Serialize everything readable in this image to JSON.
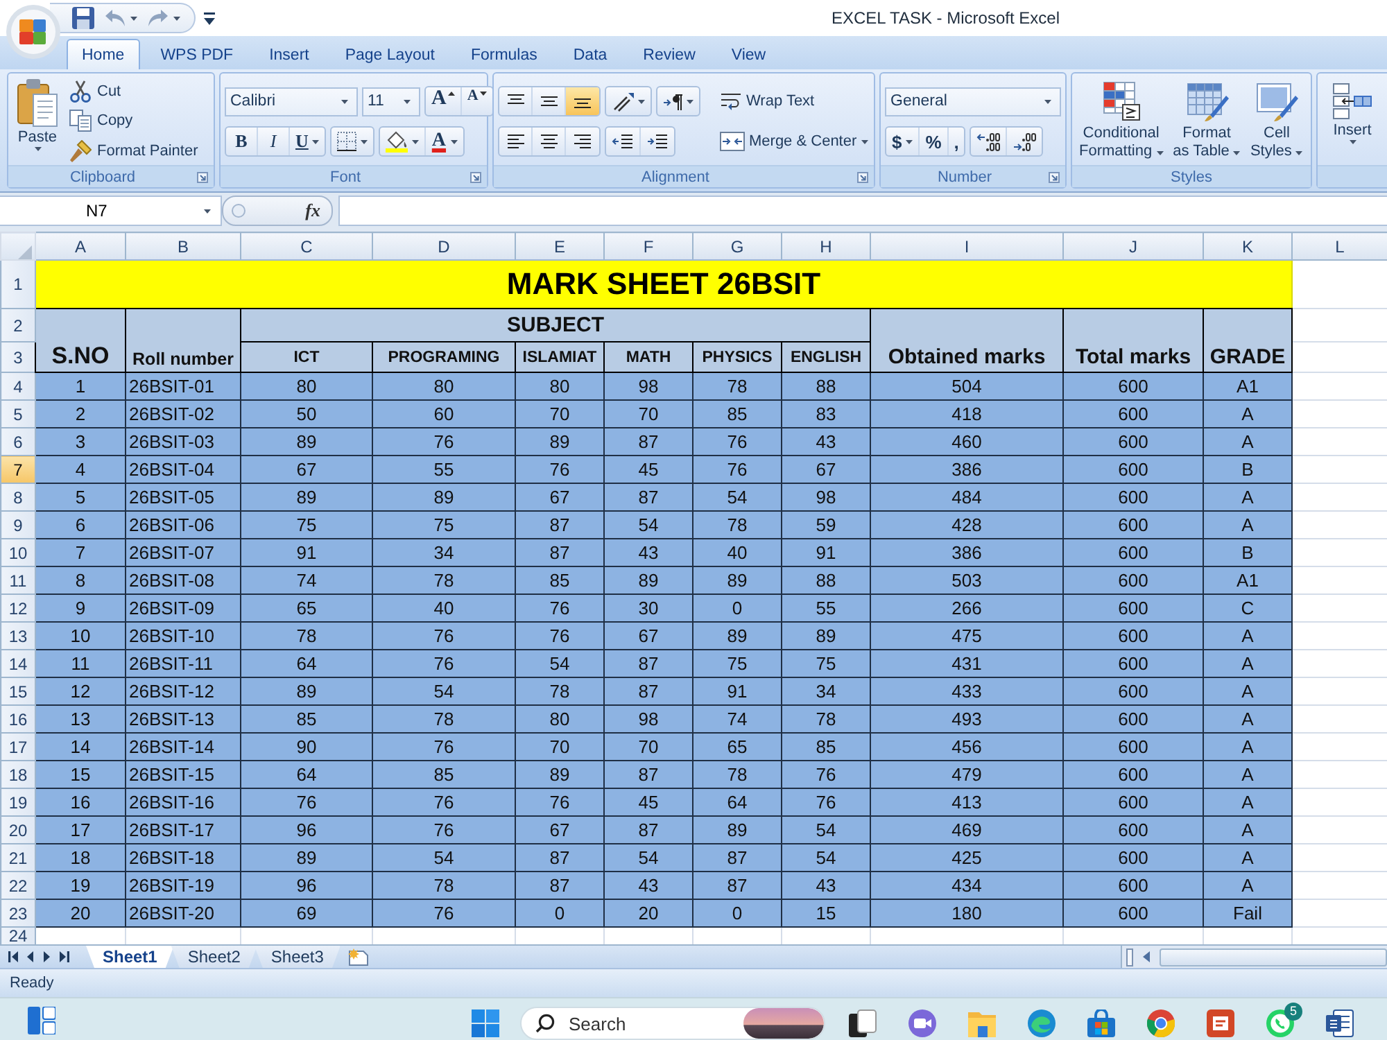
{
  "window": {
    "title": "EXCEL TASK - Microsoft Excel"
  },
  "ribbon_tabs": [
    {
      "label": "Home",
      "selected": true
    },
    {
      "label": "WPS PDF",
      "selected": false
    },
    {
      "label": "Insert",
      "selected": false
    },
    {
      "label": "Page Layout",
      "selected": false
    },
    {
      "label": "Formulas",
      "selected": false
    },
    {
      "label": "Data",
      "selected": false
    },
    {
      "label": "Review",
      "selected": false
    },
    {
      "label": "View",
      "selected": false
    }
  ],
  "clipboard": {
    "title": "Clipboard",
    "paste": "Paste",
    "cut": "Cut",
    "copy": "Copy",
    "format_painter": "Format Painter"
  },
  "font": {
    "title": "Font",
    "font_name": "Calibri",
    "font_size": "11",
    "grow_label": "A",
    "shrink_label": "A",
    "style_buttons": [
      {
        "kind": "bold",
        "label": "B"
      },
      {
        "kind": "italic",
        "label": "I"
      },
      {
        "kind": "underline",
        "label": "U"
      }
    ],
    "font_color_label": "A"
  },
  "alignment": {
    "title": "Alignment",
    "vertical_buttons": [
      {
        "kind": "top",
        "selected": false
      },
      {
        "kind": "middle",
        "selected": false
      },
      {
        "kind": "bottom",
        "selected": true
      }
    ],
    "wrap_text": "Wrap Text",
    "merge_center": "Merge & Center"
  },
  "number": {
    "title": "Number",
    "format": "General",
    "buttons": [
      {
        "kind": "currency",
        "label": "$"
      },
      {
        "kind": "percent",
        "label": "%"
      },
      {
        "kind": "comma",
        "label": ","
      }
    ]
  },
  "styles": {
    "title": "Styles",
    "buttons": [
      {
        "kind": "conditional",
        "label": "Conditional Formatting"
      },
      {
        "kind": "table",
        "label": "Format as Table"
      },
      {
        "kind": "cell",
        "label": "Cell Styles"
      }
    ]
  },
  "cells": {
    "insert": "Insert"
  },
  "formula_bar": {
    "name_box": "N7",
    "function_label": "fx"
  },
  "sheet": {
    "columns": [
      "A",
      "B",
      "C",
      "D",
      "E",
      "F",
      "G",
      "H",
      "I",
      "J",
      "K",
      "L"
    ],
    "row_numbers": [
      {
        "label": "1",
        "selected": false
      },
      {
        "label": "2",
        "selected": false
      },
      {
        "label": "3",
        "selected": false
      },
      {
        "label": "4",
        "selected": false
      },
      {
        "label": "5",
        "selected": false
      },
      {
        "label": "6",
        "selected": false
      },
      {
        "label": "7",
        "selected": true
      },
      {
        "label": "8",
        "selected": false
      },
      {
        "label": "9",
        "selected": false
      },
      {
        "label": "10",
        "selected": false
      },
      {
        "label": "11",
        "selected": false
      },
      {
        "label": "12",
        "selected": false
      },
      {
        "label": "13",
        "selected": false
      },
      {
        "label": "14",
        "selected": false
      },
      {
        "label": "15",
        "selected": false
      },
      {
        "label": "16",
        "selected": false
      },
      {
        "label": "17",
        "selected": false
      },
      {
        "label": "18",
        "selected": false
      },
      {
        "label": "19",
        "selected": false
      },
      {
        "label": "20",
        "selected": false
      },
      {
        "label": "21",
        "selected": false
      },
      {
        "label": "22",
        "selected": false
      },
      {
        "label": "23",
        "selected": false
      },
      {
        "label": "24",
        "selected": false
      }
    ],
    "title": "MARK SHEET 26BSIT",
    "headers": {
      "s_no": "S.NO",
      "roll_number": "Roll number",
      "subject": "SUBJECT",
      "subjects": [
        "ICT",
        "PROGRAMING",
        "ISLAMIAT",
        "MATH",
        "PHYSICS",
        "ENGLISH"
      ],
      "obtained": "Obtained marks",
      "total": "Total marks",
      "grade": "GRADE"
    },
    "rows": [
      [
        "1",
        "26BSIT-01",
        "80",
        "80",
        "80",
        "98",
        "78",
        "88",
        "504",
        "600",
        "A1"
      ],
      [
        "2",
        "26BSIT-02",
        "50",
        "60",
        "70",
        "70",
        "85",
        "83",
        "418",
        "600",
        "A"
      ],
      [
        "3",
        "26BSIT-03",
        "89",
        "76",
        "89",
        "87",
        "76",
        "43",
        "460",
        "600",
        "A"
      ],
      [
        "4",
        "26BSIT-04",
        "67",
        "55",
        "76",
        "45",
        "76",
        "67",
        "386",
        "600",
        "B"
      ],
      [
        "5",
        "26BSIT-05",
        "89",
        "89",
        "67",
        "87",
        "54",
        "98",
        "484",
        "600",
        "A"
      ],
      [
        "6",
        "26BSIT-06",
        "75",
        "75",
        "87",
        "54",
        "78",
        "59",
        "428",
        "600",
        "A"
      ],
      [
        "7",
        "26BSIT-07",
        "91",
        "34",
        "87",
        "43",
        "40",
        "91",
        "386",
        "600",
        "B"
      ],
      [
        "8",
        "26BSIT-08",
        "74",
        "78",
        "85",
        "89",
        "89",
        "88",
        "503",
        "600",
        "A1"
      ],
      [
        "9",
        "26BSIT-09",
        "65",
        "40",
        "76",
        "30",
        "0",
        "55",
        "266",
        "600",
        "C"
      ],
      [
        "10",
        "26BSIT-10",
        "78",
        "76",
        "76",
        "67",
        "89",
        "89",
        "475",
        "600",
        "A"
      ],
      [
        "11",
        "26BSIT-11",
        "64",
        "76",
        "54",
        "87",
        "75",
        "75",
        "431",
        "600",
        "A"
      ],
      [
        "12",
        "26BSIT-12",
        "89",
        "54",
        "78",
        "87",
        "91",
        "34",
        "433",
        "600",
        "A"
      ],
      [
        "13",
        "26BSIT-13",
        "85",
        "78",
        "80",
        "98",
        "74",
        "78",
        "493",
        "600",
        "A"
      ],
      [
        "14",
        "26BSIT-14",
        "90",
        "76",
        "70",
        "70",
        "65",
        "85",
        "456",
        "600",
        "A"
      ],
      [
        "15",
        "26BSIT-15",
        "64",
        "85",
        "89",
        "87",
        "78",
        "76",
        "479",
        "600",
        "A"
      ],
      [
        "16",
        "26BSIT-16",
        "76",
        "76",
        "76",
        "45",
        "64",
        "76",
        "413",
        "600",
        "A"
      ],
      [
        "17",
        "26BSIT-17",
        "96",
        "76",
        "67",
        "87",
        "89",
        "54",
        "469",
        "600",
        "A"
      ],
      [
        "18",
        "26BSIT-18",
        "89",
        "54",
        "87",
        "54",
        "87",
        "54",
        "425",
        "600",
        "A"
      ],
      [
        "19",
        "26BSIT-19",
        "96",
        "78",
        "87",
        "43",
        "87",
        "43",
        "434",
        "600",
        "A"
      ],
      [
        "20",
        "26BSIT-20",
        "69",
        "76",
        "0",
        "20",
        "0",
        "15",
        "180",
        "600",
        "Fail"
      ]
    ]
  },
  "sheet_tabs": [
    {
      "label": "Sheet1",
      "selected": true
    },
    {
      "label": "Sheet2",
      "selected": false
    },
    {
      "label": "Sheet3",
      "selected": false
    }
  ],
  "status_bar": {
    "text": "Ready"
  },
  "taskbar": {
    "search": {
      "placeholder": "Search"
    },
    "notification_badge": "5"
  }
}
